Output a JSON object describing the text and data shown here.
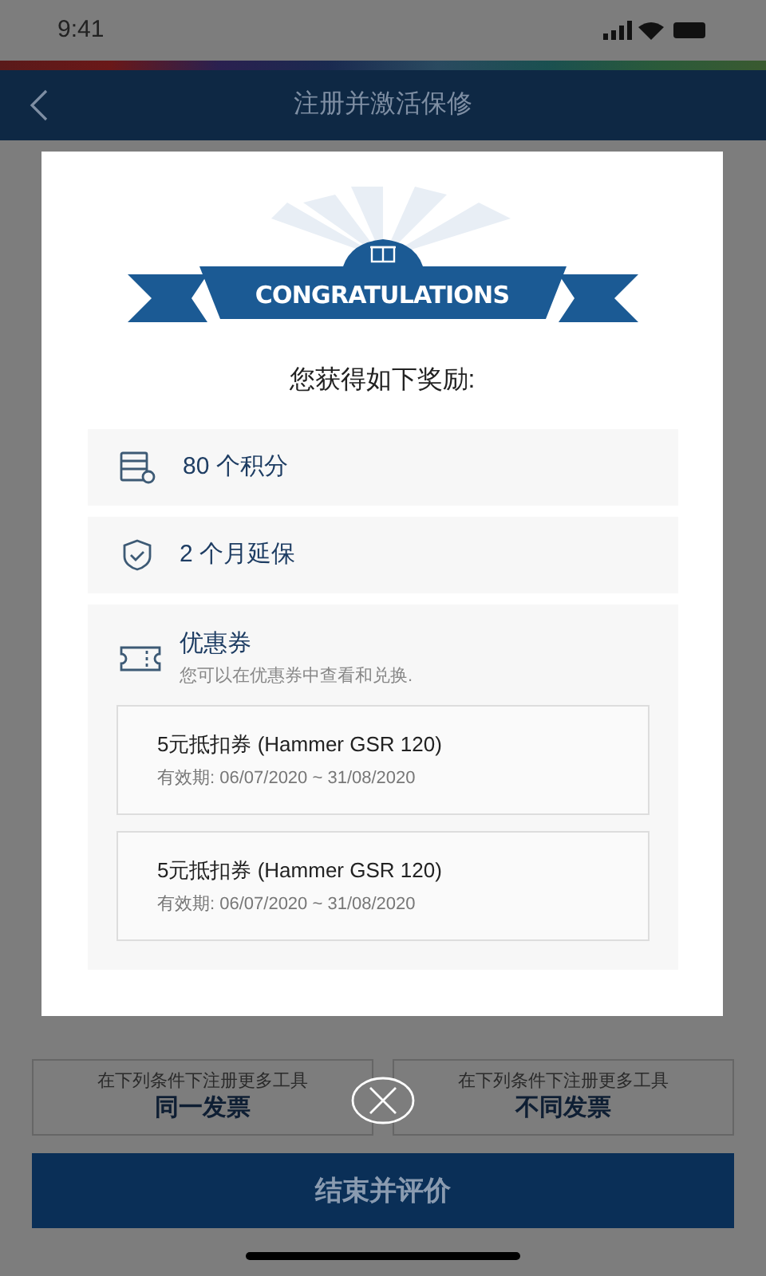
{
  "status_bar": {
    "time": "9:41"
  },
  "header": {
    "title": "注册并激活保修"
  },
  "dialog": {
    "banner": "CONGRATULATIONS",
    "heading": "您获得如下奖励:",
    "rewards": [
      {
        "kind": "points",
        "label": "80 个积分"
      },
      {
        "kind": "warranty",
        "label": "2 个月延保"
      },
      {
        "kind": "coupon",
        "label": "优惠券",
        "note": "您可以在优惠券中查看和兑换.",
        "coupons": [
          {
            "title": "5元抵扣券 (Hammer GSR 120)",
            "validity": "有效期: 06/07/2020 ~ 31/08/2020"
          },
          {
            "title": "5元抵扣券 (Hammer GSR 120)",
            "validity": "有效期: 06/07/2020 ~ 31/08/2020"
          }
        ]
      }
    ]
  },
  "options": [
    {
      "caption": "在下列条件下注册更多工具",
      "label": "同一发票"
    },
    {
      "caption": "在下列条件下注册更多工具",
      "label": "不同发票"
    }
  ],
  "primary_button": "结束并评价"
}
